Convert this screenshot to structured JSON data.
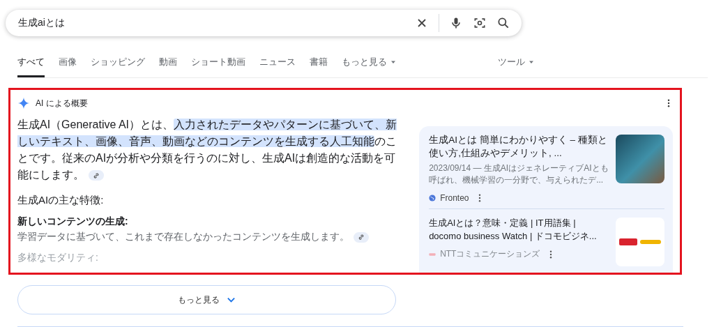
{
  "search": {
    "value": "生成aiとは"
  },
  "tabs": [
    {
      "label": "すべて",
      "selected": true,
      "dropdown": false
    },
    {
      "label": "画像",
      "selected": false,
      "dropdown": false
    },
    {
      "label": "ショッピング",
      "selected": false,
      "dropdown": false
    },
    {
      "label": "動画",
      "selected": false,
      "dropdown": false
    },
    {
      "label": "ショート動画",
      "selected": false,
      "dropdown": false
    },
    {
      "label": "ニュース",
      "selected": false,
      "dropdown": false
    },
    {
      "label": "書籍",
      "selected": false,
      "dropdown": false
    },
    {
      "label": "もっと見る",
      "selected": false,
      "dropdown": true
    }
  ],
  "tools": {
    "label": "ツール"
  },
  "overview": {
    "title": "AI による概要",
    "intro": [
      {
        "text": "生成AI（Generative AI）とは、",
        "highlighted": false
      },
      {
        "text": "入力されたデータやパターンに基づいて、新しいテキスト、画像、音声、動画などのコンテンツを生成する人工知能",
        "highlighted": true
      },
      {
        "text": "のことです。従来のAIが分析や分類を行うのに対し、生成AIは創造的な活動を可能にします。",
        "highlighted": false
      }
    ],
    "heading": "生成AIの主な特徴:",
    "features": [
      {
        "title": "新しいコンテンツの生成:",
        "text": "学習データに基づいて、これまで存在しなかったコンテンツを生成します。",
        "faded": false
      },
      {
        "title": "多様なモダリティ:",
        "faded": true
      }
    ]
  },
  "sources": [
    {
      "title": "生成AIとは 簡単にわかりやすく – 種類と使い方,仕組みやデメリット, ...",
      "snippet": "2023/09/14 — 生成AIはジェネレーティブAIとも呼ばれ、機械学習の一分野で、与えられたデ...",
      "site": "Fronteo",
      "kind": "photo",
      "faded": false
    },
    {
      "title": "生成AIとは？意味・定義 | IT用語集 | docomo business Watch | ドコモビジネ...",
      "site": "NTTコミュニケーションズ",
      "kind": "logo",
      "faded": true
    }
  ],
  "more_button": {
    "label": "もっと見る"
  }
}
